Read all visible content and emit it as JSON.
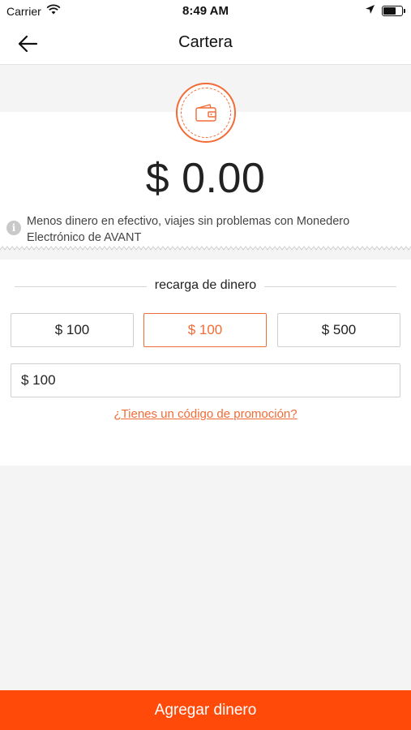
{
  "status_bar": {
    "carrier": "Carrier",
    "time": "8:49 AM"
  },
  "nav": {
    "title": "Cartera",
    "back_icon": "arrow-left-icon"
  },
  "wallet": {
    "icon": "wallet-icon",
    "balance": "$ 0.00",
    "info_text": "Menos dinero en efectivo, viajes sin problemas con Monedero Electrónico de AVANT"
  },
  "topup": {
    "title": "recarga de dinero",
    "options": [
      {
        "label": "$ 100",
        "selected": false
      },
      {
        "label": "$ 100",
        "selected": true
      },
      {
        "label": "$ 500",
        "selected": false
      }
    ],
    "amount_value": "$ 100",
    "promo_link": "¿Tienes un código de promoción?"
  },
  "footer": {
    "button_label": "Agregar dinero"
  },
  "colors": {
    "accent": "#f26b36",
    "button": "#ff4a0a",
    "background": "#f4f4f4"
  }
}
